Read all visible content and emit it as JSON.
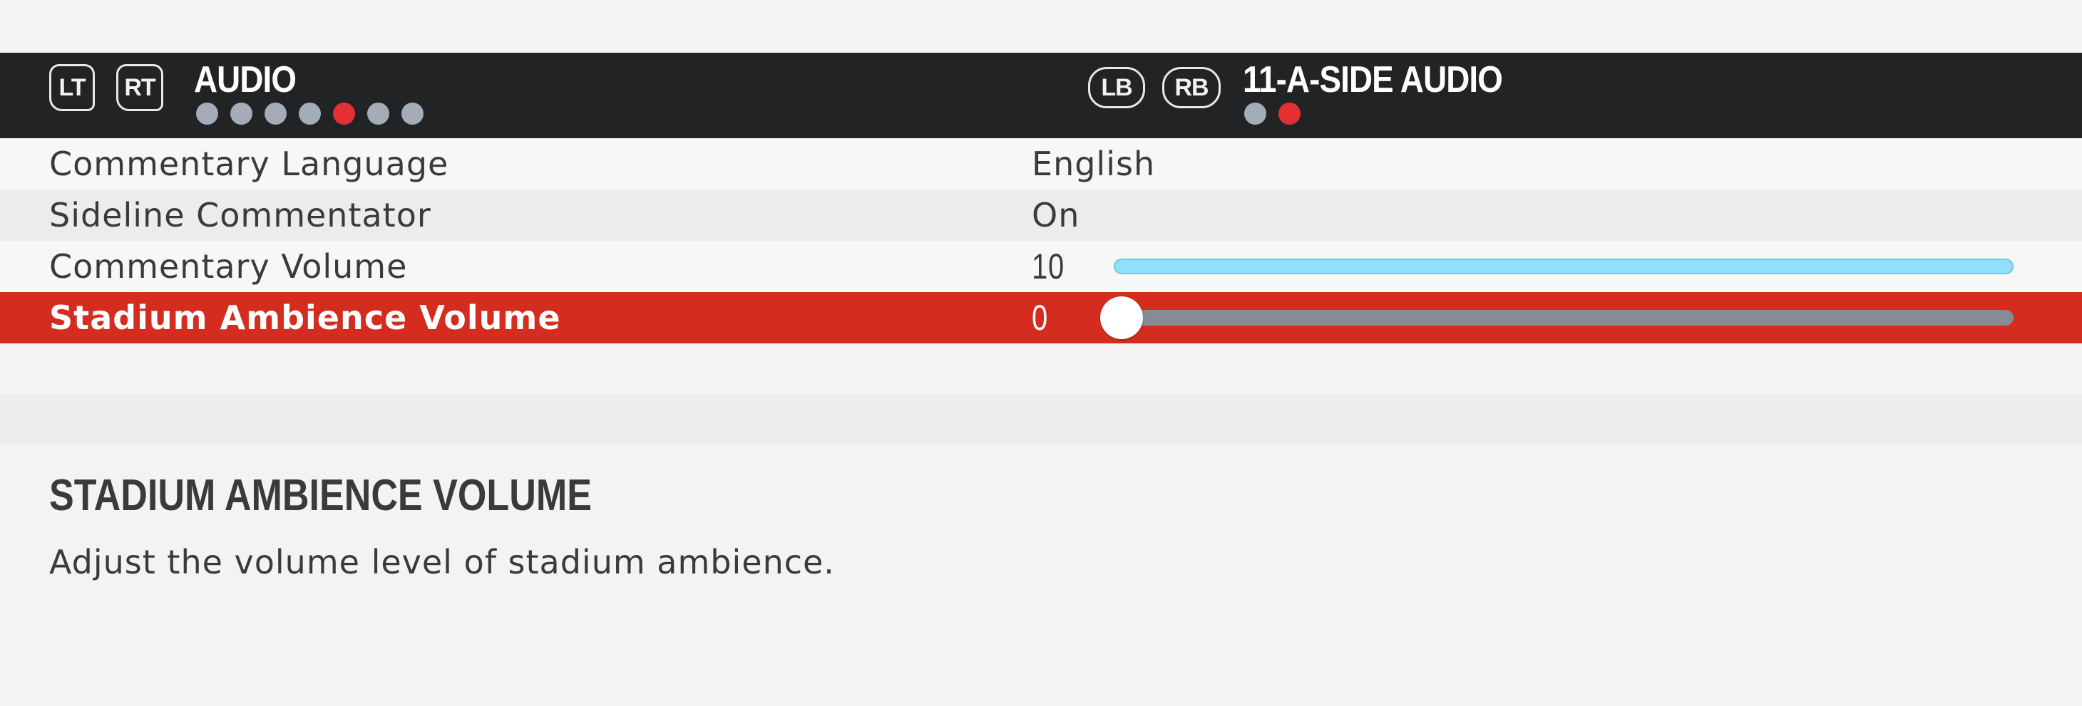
{
  "header": {
    "left": {
      "trigger_left": "LT",
      "trigger_right": "RT",
      "title": "AUDIO",
      "dots": [
        false,
        false,
        false,
        false,
        true,
        false,
        false
      ]
    },
    "right": {
      "bumper_left": "LB",
      "bumper_right": "RB",
      "title": "11-A-SIDE AUDIO",
      "dots": [
        false,
        true
      ]
    }
  },
  "settings": [
    {
      "label": "Commentary Language",
      "value": "English"
    },
    {
      "label": "Sideline Commentator",
      "value": "On"
    },
    {
      "label": "Commentary Volume",
      "value": "10",
      "slider_fraction": 1.0
    },
    {
      "label": "Stadium Ambience Volume",
      "value": "0",
      "slider_fraction": 0.0,
      "selected": true
    }
  ],
  "description": {
    "title": "STADIUM AMBIENCE VOLUME",
    "text": "Adjust the volume level of stadium ambience."
  },
  "colors": {
    "header_bg": "#222325",
    "accent_red": "#d42d20",
    "dot_active": "#e53033",
    "dot_inactive": "#a4adb7",
    "slider_full": "#8fe0f8",
    "slider_empty": "#878b93"
  }
}
